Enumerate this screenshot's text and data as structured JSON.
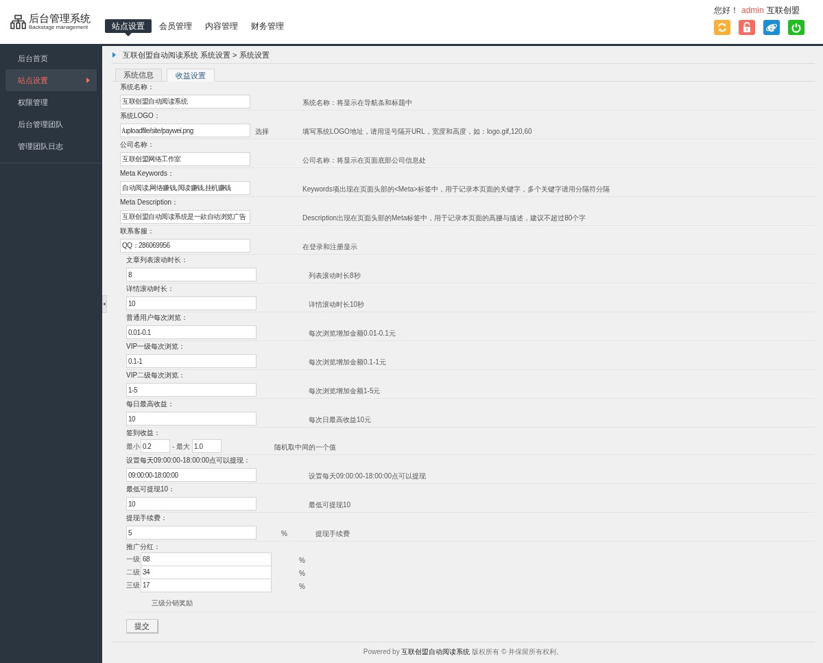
{
  "header": {
    "logo_title": "后台管理系统",
    "logo_subtitle": "Backstage management",
    "nav": [
      {
        "label": "站点设置",
        "selected": true
      },
      {
        "label": "会员管理",
        "selected": false
      },
      {
        "label": "内容管理",
        "selected": false
      },
      {
        "label": "财务管理",
        "selected": false
      }
    ],
    "greeting": "您好！",
    "user": "admin",
    "org": "互联创盟",
    "tools": [
      {
        "kind": "refresh",
        "color": "#fbb034"
      },
      {
        "kind": "lock",
        "color": "#fc6c5e"
      },
      {
        "kind": "browser",
        "color": "#1b8ed6"
      },
      {
        "kind": "power",
        "color": "#1fbf1f"
      }
    ]
  },
  "sidebar": {
    "items": [
      {
        "label": "后台首页",
        "selected": false
      },
      {
        "label": "站点设置",
        "selected": true
      },
      {
        "label": "权限管理",
        "selected": false
      },
      {
        "label": "后台管理团队",
        "selected": false
      },
      {
        "label": "管理团队日志",
        "selected": false
      }
    ]
  },
  "breadcrumb": "互联创盟自动阅读系统 系统设置 > 系统设置",
  "tabs": [
    {
      "label": "系统信息",
      "selected": false
    },
    {
      "label": "收益设置",
      "selected": true
    }
  ],
  "basic_fields": [
    {
      "kind": "text",
      "label": "系统名称：",
      "value": "互联创盟自动阅读系统",
      "hint": "系统名称：将显示在导航条和标题中"
    },
    {
      "kind": "text",
      "label": "系统LOGO：",
      "value": "/uploadfile/site/paywei.png",
      "suffix": "选择",
      "hint": "填写系统LOGO地址，请用逗号隔开URL，宽度和高度，如：logo.gif,120,60"
    },
    {
      "kind": "text",
      "label": "公司名称：",
      "value": "互联创盟网络工作室",
      "hint": "公司名称：将显示在页面底部公司信息处"
    },
    {
      "kind": "text",
      "label": "Meta Keywords：",
      "value": "自动阅读,网络赚钱,阅读赚钱,挂机赚钱",
      "hint": "Keywords项出现在页面头部的<Meta>标签中，用于记录本页面的关键字，多个关键字请用分隔符分隔"
    },
    {
      "kind": "text",
      "label": "Meta Description：",
      "value": "互联创盟自动阅读系统是一款自动浏览广告",
      "hint": "Description出现在页面头部的Meta标签中，用于记录本页面的高腰与描述，建议不超过80个字"
    },
    {
      "kind": "text",
      "label": "联系客服：",
      "value": "QQ：286069956",
      "hint": "在登录和注册显示"
    }
  ],
  "income_fields": [
    {
      "kind": "text",
      "label": "文章列表滚动时长：",
      "value": "8",
      "hint": "列表滚动时长8秒"
    },
    {
      "kind": "text",
      "label": "详情滚动时长：",
      "value": "10",
      "hint": "详情滚动时长10秒"
    },
    {
      "kind": "text",
      "label": "普通用户每次浏览：",
      "value": "0.01-0.1",
      "hint": "每次浏览增加金额0.01-0.1元"
    },
    {
      "kind": "text",
      "label": "VIP一级每次浏览：",
      "value": "0.1-1",
      "hint": "每次浏览增加金额0.1-1元"
    },
    {
      "kind": "text",
      "label": "VIP二级每次浏览：",
      "value": "1-5",
      "hint": "每次浏览增加金额1-5元"
    },
    {
      "kind": "text",
      "label": "每日最高收益：",
      "value": "10",
      "hint": "每次日最高收益10元"
    },
    {
      "kind": "range",
      "label": "签到收益：",
      "min_label": "最小",
      "min": "0.2",
      "max_label": "- 最大",
      "max": "1.0",
      "hint": "随机取中间的一个值"
    },
    {
      "kind": "text",
      "label": "设置每天09:00:00-18:00:00点可以提现：",
      "value": "09:00:00-18:00:00",
      "hint": "设置每天09:00:00-18:00:00点可以提现"
    },
    {
      "kind": "text",
      "label": "最低可提现10：",
      "value": "10",
      "hint": "最低可提现10"
    },
    {
      "kind": "text",
      "label": "提现手续费：",
      "value": "5",
      "suffix": "%",
      "hint": "提现手续费"
    },
    {
      "kind": "tiers",
      "label": "推广分红：",
      "tiers": [
        {
          "label": "一级",
          "value": "68",
          "unit": "%"
        },
        {
          "label": "二级",
          "value": "34",
          "unit": "%"
        },
        {
          "label": "三级",
          "value": "17",
          "unit": "%"
        }
      ],
      "note": "三级分销奖励"
    }
  ],
  "submit": "提交",
  "footer": {
    "powered": "Powered by",
    "brand": "互联创盟自动阅读系统",
    "rights": "版权所有 © 并保留所有权利。"
  }
}
